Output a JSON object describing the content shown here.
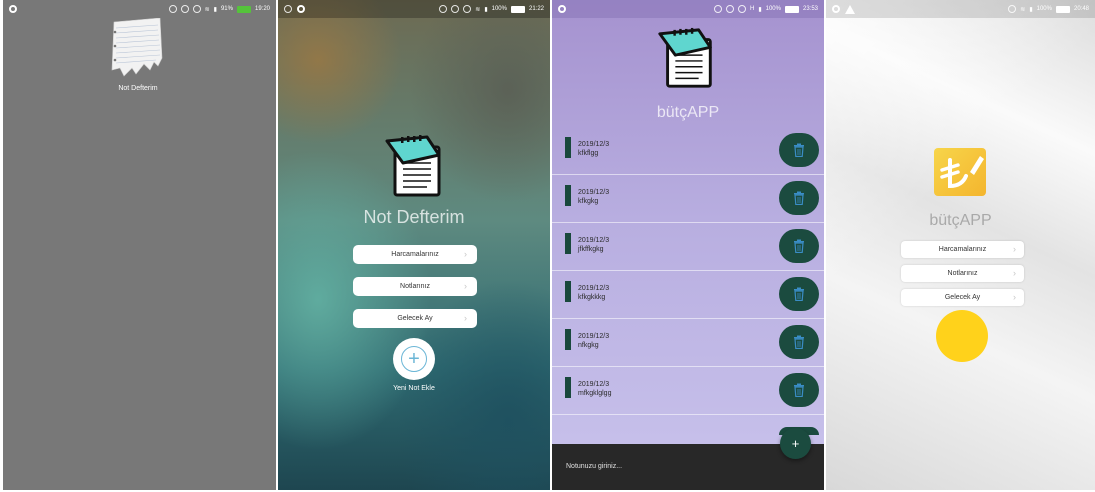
{
  "panel1": {
    "status": {
      "battery": "91%",
      "time": "19:20"
    },
    "launcher": {
      "label": "Not Defterim",
      "icon": "paper-note-icon"
    }
  },
  "panel2": {
    "status": {
      "battery": "100%",
      "time": "21:22"
    },
    "title": "Not Defterim",
    "menu": [
      {
        "label": "Harcamalarınız"
      },
      {
        "label": "Notlarınız"
      },
      {
        "label": "Gelecek Ay"
      }
    ],
    "add_label": "Yeni Not Ekle"
  },
  "panel3": {
    "status": {
      "battery": "100%",
      "time": "23:53"
    },
    "title": "bütçAPP",
    "notes": [
      {
        "date": "2019/12/3",
        "text": "kfkflgg"
      },
      {
        "date": "2019/12/3",
        "text": "kfkgkg"
      },
      {
        "date": "2019/12/3",
        "text": "jfkffkgkg"
      },
      {
        "date": "2019/12/3",
        "text": "kfkgkkkg"
      },
      {
        "date": "2019/12/3",
        "text": "nfkgkg"
      },
      {
        "date": "2019/12/3",
        "text": "mfkgklglgg"
      }
    ],
    "input_placeholder": "Notunuzu giriniz...",
    "fab_label": "+"
  },
  "panel4": {
    "status": {
      "battery": "100%",
      "time": "20:48"
    },
    "title": "bütçAPP",
    "menu": [
      {
        "label": "Harcamalarınız"
      },
      {
        "label": "Notlarınız"
      },
      {
        "label": "Gelecek Ay"
      }
    ]
  },
  "colors": {
    "note_accent": "#1b4b3f",
    "notepad_teal": "#5fd6cf",
    "lira_yellow": "#f7c93a",
    "circle_yellow": "#ffd21b"
  }
}
